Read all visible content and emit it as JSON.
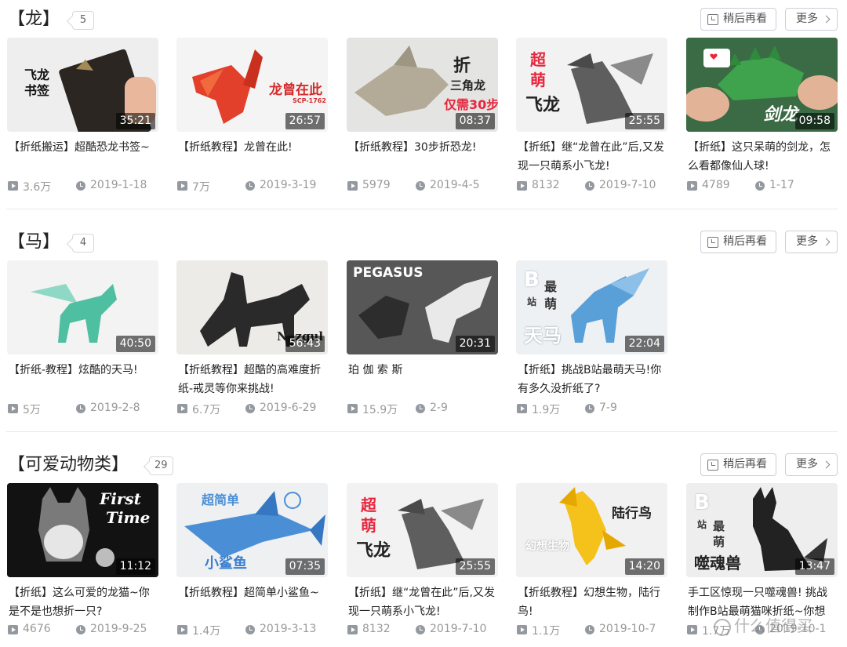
{
  "buttons": {
    "watch_later": "稍后再看",
    "more": "更多"
  },
  "sections": [
    {
      "title": "【龙】",
      "count": "5",
      "cards": [
        {
          "duration": "35:21",
          "title": "【折纸搬运】超酷恐龙书签~",
          "views": "3.6万",
          "date": "2019-1-18",
          "overlay": [
            "飞龙",
            "书签"
          ]
        },
        {
          "duration": "26:57",
          "title": "【折纸教程】龙曾在此!",
          "views": "7万",
          "date": "2019-3-19",
          "overlay": [
            "龙曾在此",
            "SCP-1762"
          ]
        },
        {
          "duration": "08:37",
          "title": "【折纸教程】30步折恐龙!",
          "views": "5979",
          "date": "2019-4-5",
          "overlay": [
            "折",
            "三角龙",
            "仅需30步"
          ]
        },
        {
          "duration": "25:55",
          "title": "【折纸】继“龙曾在此”后,又发现一只萌系小飞龙!",
          "views": "8132",
          "date": "2019-7-10",
          "overlay": [
            "超",
            "萌",
            "飞龙"
          ]
        },
        {
          "duration": "09:58",
          "title": "【折纸】这只呆萌的剑龙，怎么看都像仙人球!",
          "views": "4789",
          "date": "1-17",
          "overlay": [
            "剑龙"
          ]
        }
      ]
    },
    {
      "title": "【马】",
      "count": "4",
      "cards": [
        {
          "duration": "40:50",
          "title": "【折纸-教程】炫酷的天马!",
          "views": "5万",
          "date": "2019-2-8",
          "overlay": []
        },
        {
          "duration": "56:43",
          "title": "【折纸教程】超酷的高难度折纸-戒灵等你来挑战!",
          "views": "6.7万",
          "date": "2019-6-29",
          "overlay": [
            "Nazgul"
          ]
        },
        {
          "duration": "20:31",
          "title": "珀 伽 索 斯",
          "views": "15.9万",
          "date": "2-9",
          "overlay": [
            "PEGASUS"
          ]
        },
        {
          "duration": "22:04",
          "title": "【折纸】挑战B站最萌天马!你有多久没折纸了?",
          "views": "1.9万",
          "date": "7-9",
          "overlay": [
            "B",
            "站",
            "最",
            "萌",
            "天马"
          ]
        }
      ]
    },
    {
      "title": "【可爱动物类】",
      "count": "29",
      "cards": [
        {
          "duration": "11:12",
          "title": "【折纸】这么可爱的龙猫~你是不是也想折一只?",
          "views": "4676",
          "date": "2019-9-25",
          "overlay": [
            "First",
            "Time"
          ]
        },
        {
          "duration": "07:35",
          "title": "【折纸教程】超简单小鲨鱼~",
          "views": "1.4万",
          "date": "2019-3-13",
          "overlay": [
            "超简单",
            "小鲨鱼"
          ]
        },
        {
          "duration": "25:55",
          "title": "【折纸】继“龙曾在此”后,又发现一只萌系小飞龙!",
          "views": "8132",
          "date": "2019-7-10",
          "overlay": [
            "超",
            "萌",
            "飞龙"
          ]
        },
        {
          "duration": "14:20",
          "title": "【折纸教程】幻想生物，陆行鸟!",
          "views": "1.1万",
          "date": "2019-10-7",
          "overlay": [
            "陆行鸟",
            "幻想生物"
          ]
        },
        {
          "duration": "13:47",
          "title": "手工区惊现一只噬魂兽! 挑战制作B站最萌猫咪折纸~你想",
          "views": "1.7万",
          "date": "2019-10-1",
          "overlay": [
            "B",
            "站",
            "最",
            "萌",
            "噬魂兽"
          ]
        }
      ]
    }
  ],
  "watermark": "什么值得买",
  "colors": {
    "accent_red": "#e8263d",
    "muted": "#999999",
    "border": "#ccd0d7"
  }
}
